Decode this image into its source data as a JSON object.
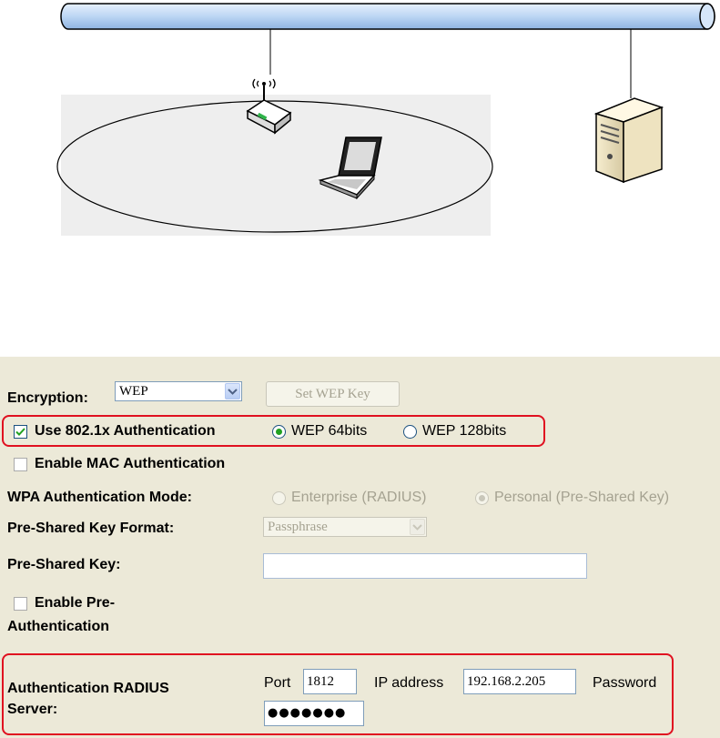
{
  "diagram": {
    "icons": [
      "wireless-router-icon",
      "laptop-icon",
      "radius-server-icon",
      "network-backbone-icon"
    ]
  },
  "form": {
    "encryption_label": "Encryption:",
    "encryption_value": "WEP",
    "set_wep_key_label": "Set WEP Key",
    "use_8021x_label": "Use 802.1x Authentication",
    "wep64_label": "WEP 64bits",
    "wep128_label": "WEP 128bits",
    "enable_mac_label": "Enable MAC Authentication",
    "wpa_mode_label": "WPA Authentication Mode:",
    "enterprise_label": "Enterprise (RADIUS)",
    "personal_label": "Personal (Pre-Shared Key)",
    "psk_format_label": "Pre-Shared Key Format:",
    "psk_format_value": "Passphrase",
    "psk_label": "Pre-Shared Key:",
    "psk_value": "",
    "preauth_label_1": "Enable Pre-",
    "preauth_label_2": "Authentication",
    "radius_label_1": "Authentication RADIUS",
    "radius_label_2": "Server:",
    "port_label": "Port",
    "port_value": "1812",
    "ip_label": "IP address",
    "ip_value": "192.168.2.205",
    "password_label": "Password",
    "password_value": "●●●●●●●"
  },
  "state": {
    "use_8021x_checked": true,
    "wep64_selected": true,
    "wep128_selected": false,
    "enable_mac_checked": false,
    "preauth_checked": false,
    "personal_selected": true
  },
  "colors": {
    "panel_bg": "#ece9d8",
    "highlight_red": "#e01020",
    "check_green": "#21a121",
    "backbone_blue": "#bcd6f4"
  }
}
